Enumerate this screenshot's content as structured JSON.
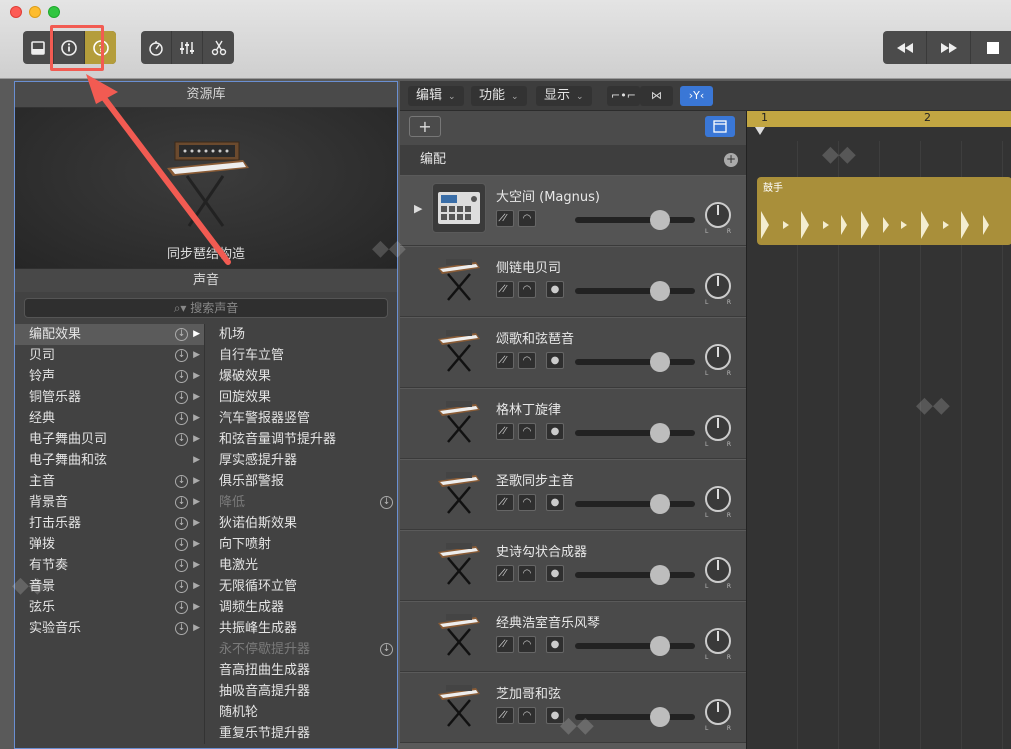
{
  "toolbar": {
    "buttons": [
      "library-icon",
      "info-icon",
      "help-icon",
      "tuner-icon",
      "mixer-icon",
      "scissors-icon"
    ],
    "transport": [
      "rewind-icon",
      "fastforward-icon",
      "stop-icon"
    ]
  },
  "library": {
    "title": "资源库",
    "preview_caption": "同步琶结构造",
    "sound_header": "声音",
    "search_placeholder": "搜索声音",
    "categories": [
      {
        "label": "编配效果",
        "selected": true
      },
      {
        "label": "贝司"
      },
      {
        "label": "铃声"
      },
      {
        "label": "铜管乐器"
      },
      {
        "label": "经典"
      },
      {
        "label": "电子舞曲贝司"
      },
      {
        "label": "电子舞曲和弦"
      },
      {
        "label": "主音"
      },
      {
        "label": "背景音"
      },
      {
        "label": "打击乐器"
      },
      {
        "label": "弹拨"
      },
      {
        "label": "有节奏"
      },
      {
        "label": "音景"
      },
      {
        "label": "弦乐"
      },
      {
        "label": "实验音乐"
      }
    ],
    "patches": [
      {
        "label": "机场"
      },
      {
        "label": "自行车立管"
      },
      {
        "label": "爆破效果"
      },
      {
        "label": "回旋效果"
      },
      {
        "label": "汽车警报器竖管"
      },
      {
        "label": "和弦音量调节提升器"
      },
      {
        "label": "厚实感提升器"
      },
      {
        "label": "俱乐部警报"
      },
      {
        "label": "降低",
        "dim": true
      },
      {
        "label": "狄诺伯斯效果"
      },
      {
        "label": "向下喷射"
      },
      {
        "label": "电激光"
      },
      {
        "label": "无限循环立管"
      },
      {
        "label": "调频生成器"
      },
      {
        "label": "共振峰生成器"
      },
      {
        "label": "永不停歇提升器",
        "dim": true
      },
      {
        "label": "音高扭曲生成器"
      },
      {
        "label": "抽吸音高提升器"
      },
      {
        "label": "随机轮"
      },
      {
        "label": "重复乐节提升器"
      }
    ]
  },
  "tracks_header": {
    "menus": [
      "编辑",
      "功能",
      "显示"
    ]
  },
  "arrange_label": "编配",
  "tracks": [
    {
      "name": "大空间 (Magnus)",
      "type": "drum"
    },
    {
      "name": "侧链电贝司",
      "type": "synth"
    },
    {
      "name": "颂歌和弦琶音",
      "type": "synth"
    },
    {
      "name": "格林丁旋律",
      "type": "synth"
    },
    {
      "name": "圣歌同步主音",
      "type": "synth"
    },
    {
      "name": "史诗勾状合成器",
      "type": "synth"
    },
    {
      "name": "经典浩室音乐风琴",
      "type": "synth"
    },
    {
      "name": "芝加哥和弦",
      "type": "synth"
    }
  ],
  "timeline": {
    "bars": [
      "1",
      "2"
    ],
    "region_name": "鼓手"
  },
  "colors": {
    "accent_gold": "#b49d3b",
    "highlight_red": "#f25b52",
    "selection_blue": "#3a77d6"
  }
}
